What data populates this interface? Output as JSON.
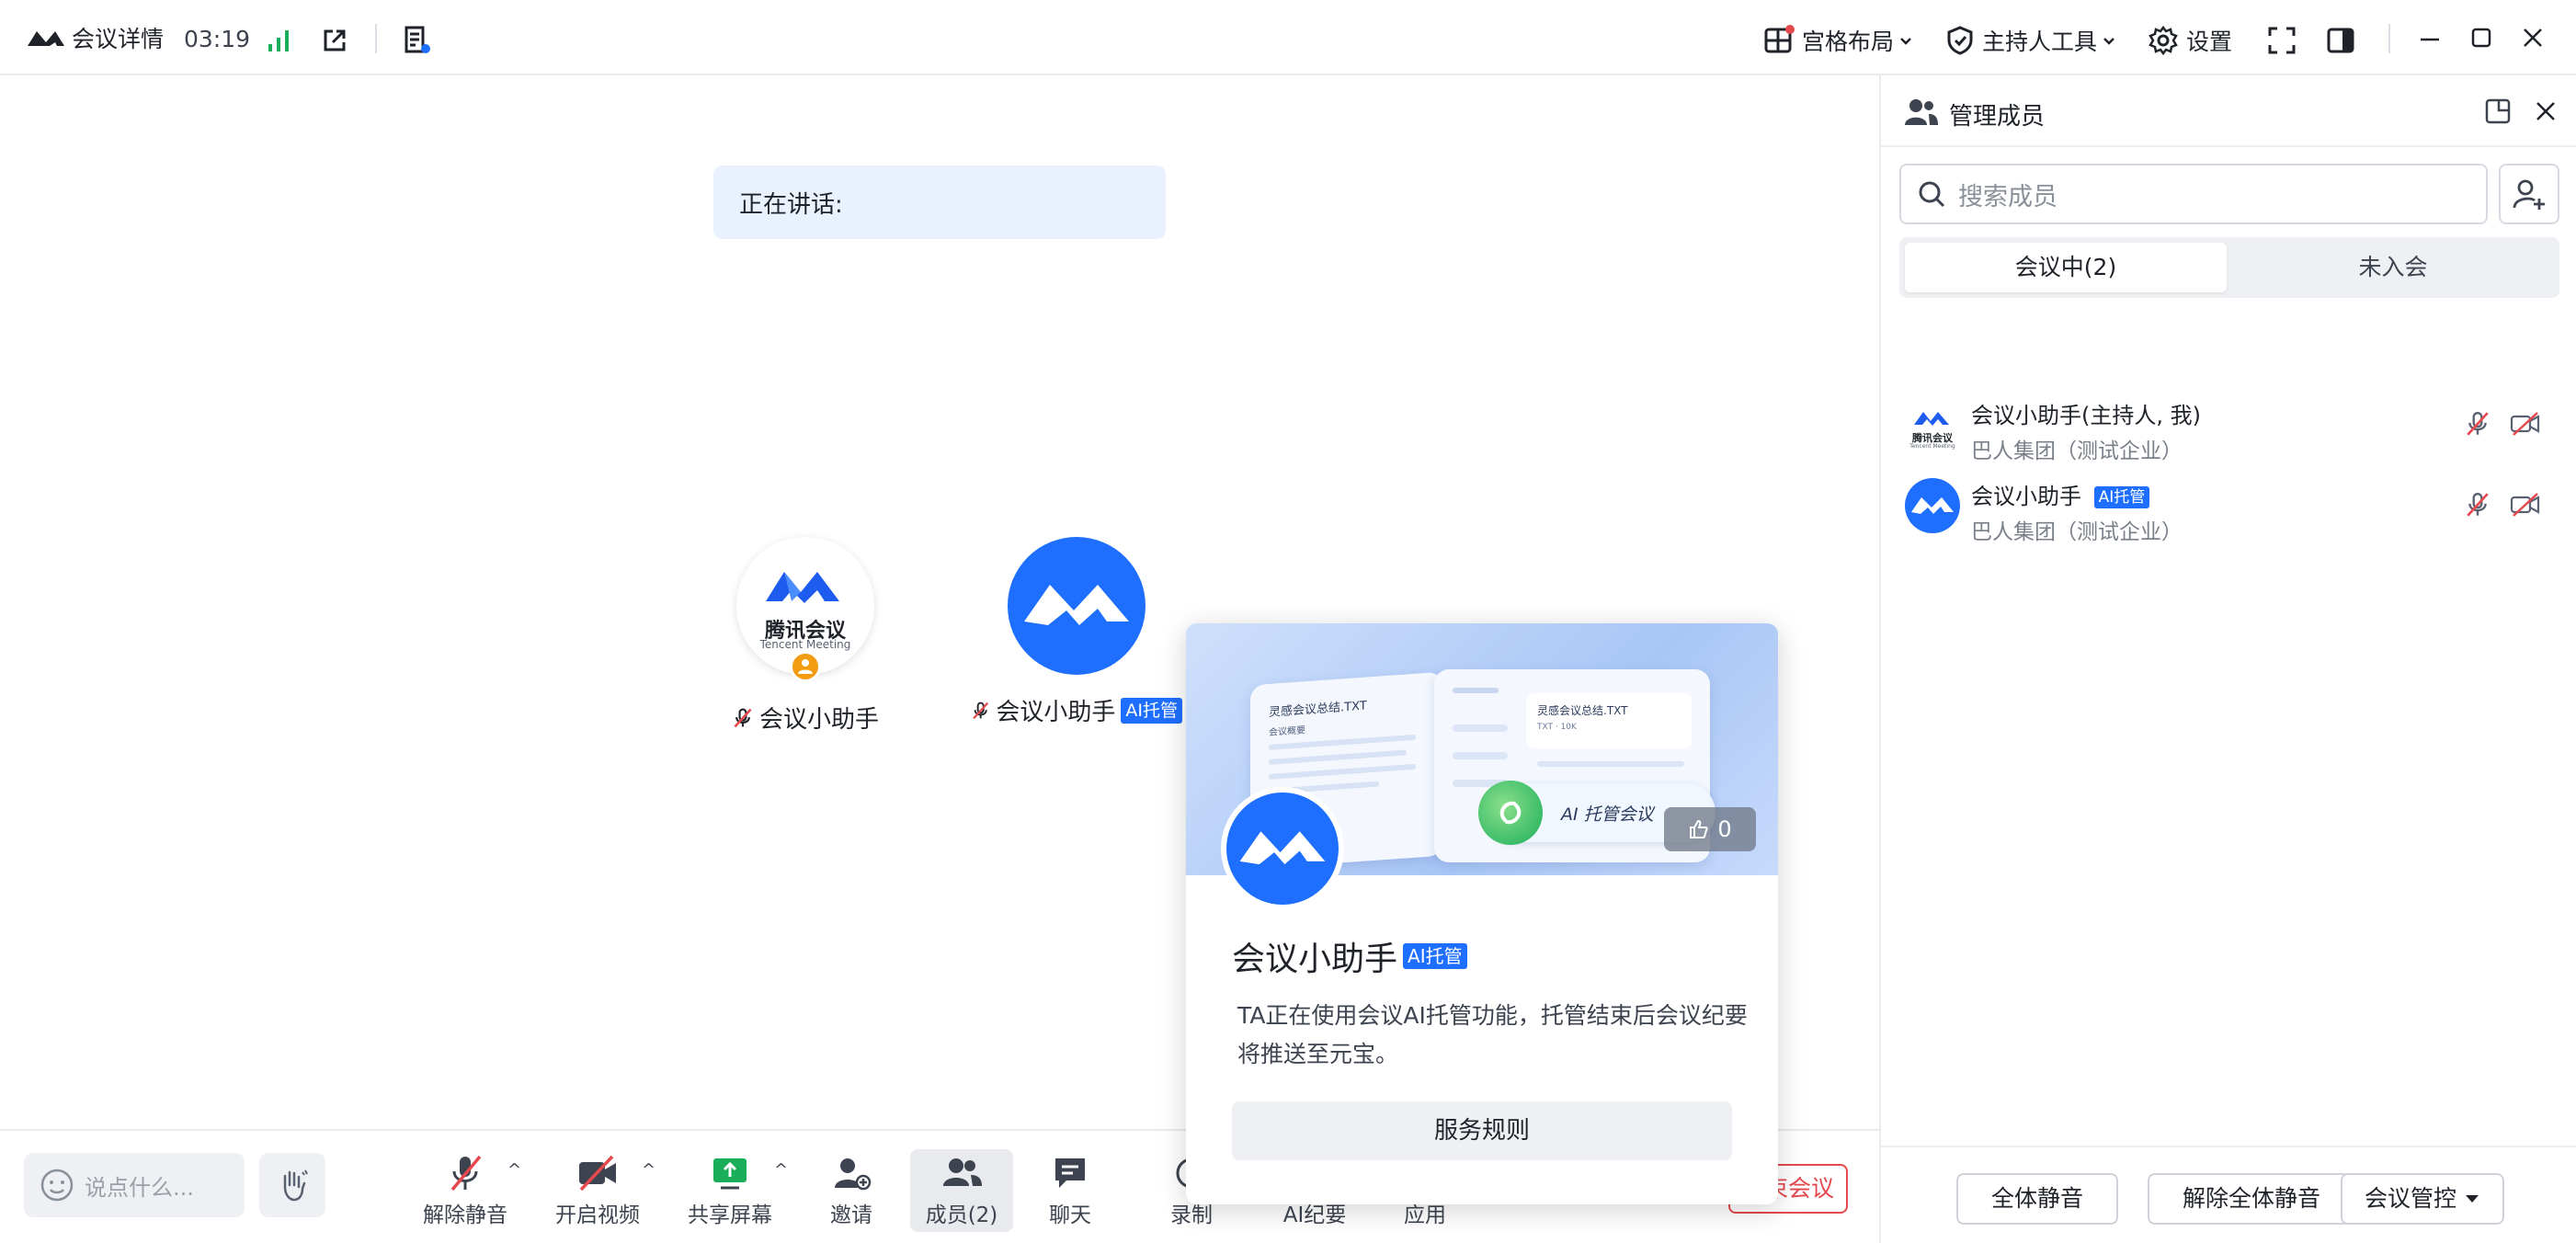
{
  "topbar": {
    "title": "会议详情",
    "timer": "03:19",
    "layout_label": "宫格布局",
    "host_tools_label": "主持人工具",
    "settings_label": "设置"
  },
  "main": {
    "speaking_label": "正在讲话:",
    "participants": [
      {
        "name": "会议小助手",
        "logo_text": "腾讯会议",
        "logo_subtext": "Tencent Meeting"
      },
      {
        "name": "会议小助手",
        "badge": "AI托管"
      }
    ]
  },
  "toolbar": {
    "chat_placeholder": "说点什么...",
    "unmute": "解除静音",
    "start_video": "开启视频",
    "share_screen": "共享屏幕",
    "invite": "邀请",
    "members": "成员(2)",
    "chat": "聊天",
    "record": "录制",
    "ai_minutes": "AI纪要",
    "apps": "应用",
    "end_meeting": "结束会议"
  },
  "panel": {
    "title": "管理成员",
    "search_placeholder": "搜索成员",
    "tabs": [
      "会议中(2)",
      "未入会"
    ],
    "members": [
      {
        "name": "会议小助手",
        "role": "(主持人, 我)",
        "org": "巴人集团（测试企业）",
        "logo_text": "腾讯会议",
        "logo_subtext": "Tencent Meeting"
      },
      {
        "name": "会议小助手",
        "badge": "AI托管",
        "org": "巴人集团（测试企业）"
      }
    ],
    "footer": {
      "mute_all": "全体静音",
      "unmute_all": "解除全体静音",
      "meeting_control": "会议管控"
    }
  },
  "card": {
    "doc1_title": "灵感会议总结.TXT",
    "doc1_sub": "会议概要",
    "doc2_title": "灵感会议总结.TXT",
    "doc2_sub": "TXT · 10K",
    "pill_label": "AI 托管会议",
    "like_count": "0",
    "name": "会议小助手",
    "badge": "AI托管",
    "description": "TA正在使用会议AI托管功能，托管结束后会议纪要将推送至元宝。",
    "rules_button": "服务规则"
  },
  "colors": {
    "accent": "#1e6fff",
    "danger": "#e5484d",
    "signal": "#1aad5a"
  }
}
